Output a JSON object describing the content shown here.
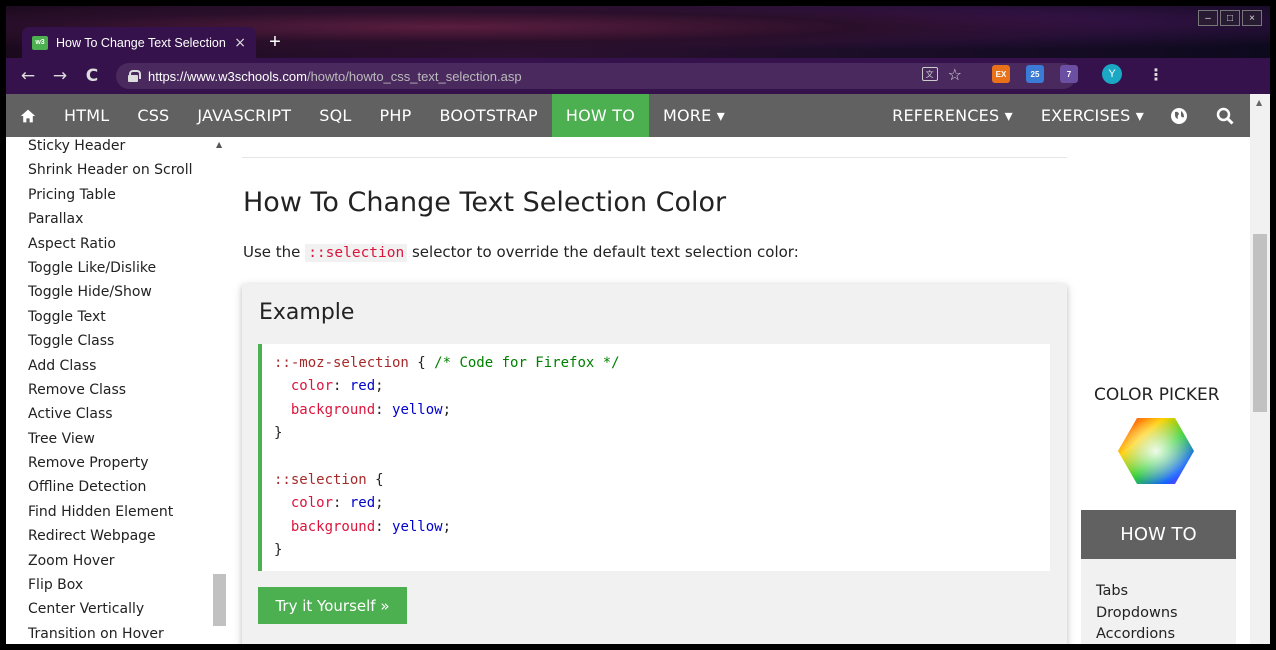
{
  "browser": {
    "tab_title": "How To Change Text Selection C",
    "tab_close": "×",
    "new_tab": "+",
    "url_host": "https://www.w3schools.com",
    "url_path": "/howto/howto_css_text_selection.asp",
    "window_controls": [
      "–",
      "□",
      "×"
    ],
    "extensions": [
      {
        "name": "ex-extension-icon",
        "label": "EX",
        "color": "#e8711a"
      },
      {
        "name": "badge-extension-icon",
        "label": "25",
        "color": "#3a7bd5"
      },
      {
        "name": "v-extension-icon",
        "label": "7",
        "color": "#6a4fa3"
      }
    ],
    "profile_initial": "Y"
  },
  "navbar": {
    "items": [
      "HTML",
      "CSS",
      "JAVASCRIPT",
      "SQL",
      "PHP",
      "BOOTSTRAP",
      "HOW TO",
      "MORE ▾"
    ],
    "active": "HOW TO",
    "right_items": [
      "REFERENCES ▾",
      "EXERCISES ▾"
    ],
    "accent": "#4caf50",
    "bg": "#616161"
  },
  "sidebar": {
    "items": [
      "Sticky Header",
      "Shrink Header on Scroll",
      "Pricing Table",
      "Parallax",
      "Aspect Ratio",
      "Toggle Like/Dislike",
      "Toggle Hide/Show",
      "Toggle Text",
      "Toggle Class",
      "Add Class",
      "Remove Class",
      "Active Class",
      "Tree View",
      "Remove Property",
      "Offline Detection",
      "Find Hidden Element",
      "Redirect Webpage",
      "Zoom Hover",
      "Flip Box",
      "Center Vertically",
      "Transition on Hover"
    ]
  },
  "main": {
    "title": "How To Change Text Selection Color",
    "intro_before": "Use the ",
    "intro_code": "::selection",
    "intro_after": " selector to override the default text selection color:",
    "example_title": "Example",
    "code": {
      "l1_sel": "::-moz-selection",
      "l1_brace": " { ",
      "l1_comment": "/* Code for Firefox */",
      "prop_color": "color",
      "val_red": "red",
      "prop_bg": "background",
      "val_yellow": "yellow",
      "close": "}",
      "l2_sel": "::selection",
      "l2_brace": " {"
    },
    "try_button": "Try it Yourself »"
  },
  "right": {
    "color_picker_title": "COLOR PICKER",
    "howto_title": "HOW TO",
    "howto_links": [
      "Tabs",
      "Dropdowns",
      "Accordions"
    ]
  }
}
